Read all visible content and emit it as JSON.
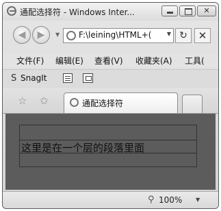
{
  "window": {
    "title": "通配选择符 - Windows Inter..."
  },
  "nav": {
    "address": "F:\\leining\\HTML+("
  },
  "menu": [
    {
      "label": "文件(F)"
    },
    {
      "label": "编辑(E)"
    },
    {
      "label": "查看(V)"
    },
    {
      "label": "收藏夹(A)"
    },
    {
      "label": "工具("
    }
  ],
  "toolbar": {
    "snagit_label": "SnagIt"
  },
  "tabs": [
    {
      "label": "通配选择符"
    }
  ],
  "content": {
    "paragraph": "这里是在一个层的段落里面"
  },
  "status": {
    "zoom": "100%"
  }
}
